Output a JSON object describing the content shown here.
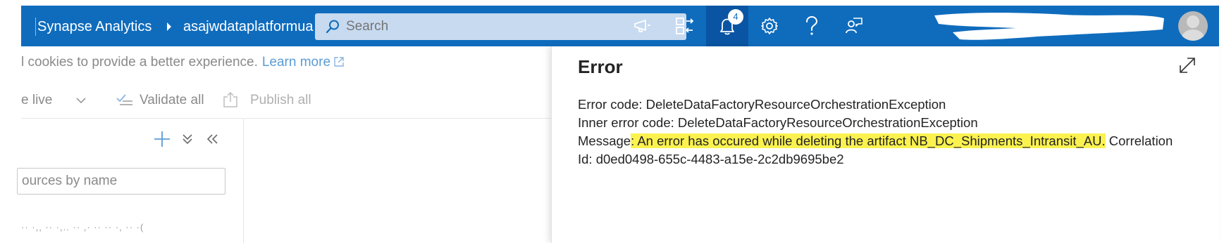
{
  "header": {
    "brand": "Synapse Analytics",
    "workspace": "asajwdataplatformua",
    "search": {
      "placeholder": "Search"
    },
    "notifications_count": "4",
    "icons": [
      "feedback-icon",
      "directory-switch-icon",
      "bell-icon",
      "gear-icon",
      "help-icon",
      "support-icon"
    ]
  },
  "cookie_banner": {
    "text": "l cookies to provide a better experience.",
    "link": "Learn more"
  },
  "toolbar": {
    "mode_label": "e live",
    "validate_label": "Validate all",
    "publish_label": "Publish all"
  },
  "sidebar": {
    "filter_placeholder": "ources by name",
    "tree_item": "·· ·,, ·· ·,.. ·· ,· ·· ·· ·,  ·· ·(  "
  },
  "error_panel": {
    "title": "Error",
    "lines": {
      "code": "Error code: DeleteDataFactoryResourceOrchestrationException",
      "inner": "Inner error code: DeleteDataFactoryResourceOrchestrationException",
      "message_prefix": "Message",
      "message_highlight": ": An error has occured while deleting the artifact NB_DC_Shipments_Intransit_AU.",
      "message_suffix": " Correlation",
      "correlation": "Id: d0ed0498-655c-4483-a15e-2c2db9695be2"
    }
  },
  "colors": {
    "header_bg": "#0f6cbd",
    "highlight": "#fbf24f",
    "link": "#5b9bd5"
  }
}
